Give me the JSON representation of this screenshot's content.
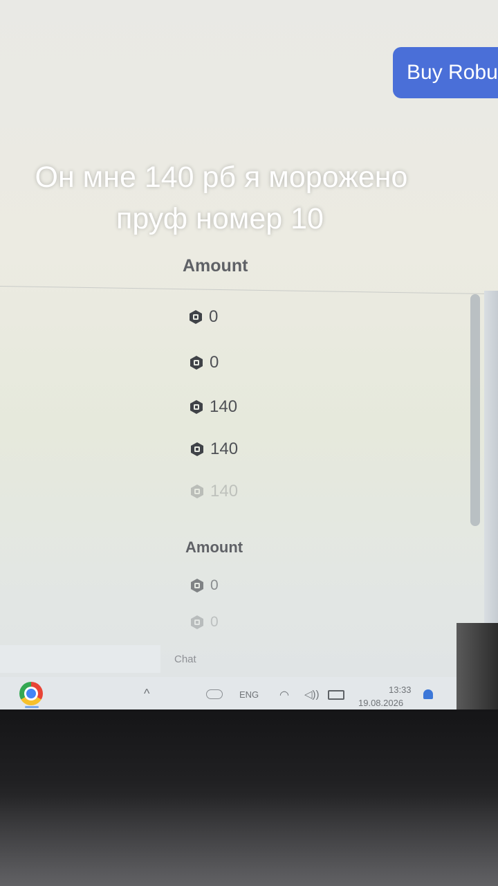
{
  "header": {
    "buy_button_label": "Buy Robux"
  },
  "caption": {
    "line1": "Он мне 140 рб я морожено",
    "line2": "пруф номер 10"
  },
  "transactions_top": {
    "column_header": "Amount",
    "amounts": [
      "0",
      "0",
      "140",
      "140",
      "140"
    ]
  },
  "transactions_bottom": {
    "column_header": "Amount",
    "amounts": [
      "0",
      "0"
    ]
  },
  "chat": {
    "label": "Chat"
  },
  "taskbar": {
    "language": "ENG",
    "time": "13:33",
    "date": "19.08.2026"
  },
  "icons": {
    "currency": "robux-icon",
    "browser": "chrome-icon",
    "wifi": "wifi-icon",
    "volume": "volume-icon",
    "battery": "battery-icon",
    "notifications": "bell-icon"
  },
  "colors": {
    "accent": "#4a6fd8"
  }
}
